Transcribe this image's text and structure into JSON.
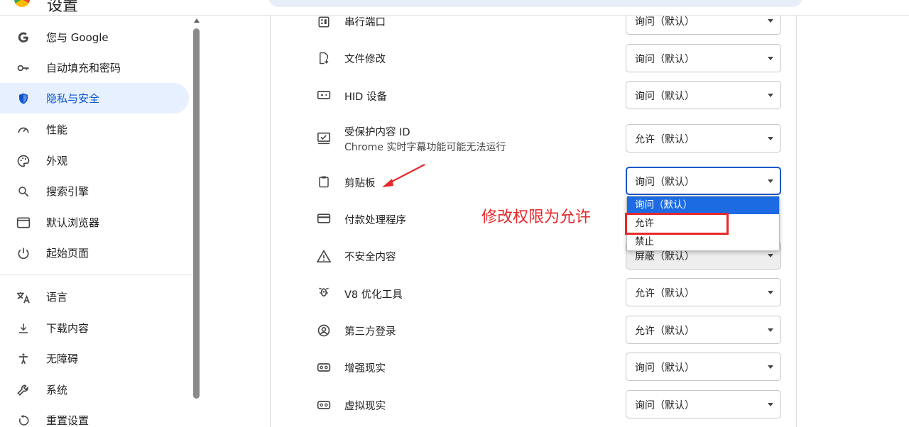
{
  "header": {
    "title": "设置"
  },
  "sidebar": {
    "items": [
      {
        "label": "您与 Google",
        "icon": "google-g-icon"
      },
      {
        "label": "自动填充和密码",
        "icon": "key-icon"
      },
      {
        "label": "隐私与安全",
        "icon": "shield-icon",
        "active": true
      },
      {
        "label": "性能",
        "icon": "gauge-icon"
      },
      {
        "label": "外观",
        "icon": "palette-icon"
      },
      {
        "label": "搜索引擎",
        "icon": "search-icon"
      },
      {
        "label": "默认浏览器",
        "icon": "browser-window-icon"
      },
      {
        "label": "起始页面",
        "icon": "power-icon"
      },
      {
        "label": "语言",
        "icon": "translate-icon"
      },
      {
        "label": "下载内容",
        "icon": "download-icon"
      },
      {
        "label": "无障碍",
        "icon": "accessibility-icon"
      },
      {
        "label": "系统",
        "icon": "wrench-icon"
      },
      {
        "label": "重置设置",
        "icon": "reset-icon"
      }
    ]
  },
  "permissions": [
    {
      "label": "串行端口",
      "icon": "serial-port-icon",
      "value": "询问（默认）"
    },
    {
      "label": "文件修改",
      "icon": "file-edit-icon",
      "value": "询问（默认）"
    },
    {
      "label": "HID 设备",
      "icon": "hid-device-icon",
      "value": "询问（默认）"
    },
    {
      "label": "受保护内容 ID",
      "sublabel": "Chrome 实时字幕功能可能无法运行",
      "icon": "protected-content-icon",
      "value": "允许（默认）"
    },
    {
      "label": "剪贴板",
      "icon": "clipboard-icon",
      "value": "询问（默认）"
    },
    {
      "label": "付款处理程序",
      "icon": "credit-card-icon",
      "value": ""
    },
    {
      "label": "不安全内容",
      "icon": "warning-icon",
      "value": "屏蔽（默认）"
    },
    {
      "label": "V8 优化工具",
      "icon": "v8-icon",
      "value": "允许（默认）"
    },
    {
      "label": "第三方登录",
      "icon": "account-circle-icon",
      "value": "允许（默认）"
    },
    {
      "label": "增强现实",
      "icon": "ar-icon",
      "value": "询问（默认）"
    },
    {
      "label": "虚拟现实",
      "icon": "vr-icon",
      "value": "询问（默认）"
    }
  ],
  "dropdown": {
    "options": [
      "询问（默认）",
      "允许",
      "禁止"
    ],
    "highlighted": 0
  },
  "annotation": {
    "text": "修改权限为允许"
  },
  "colors": {
    "accent": "#0b57d0",
    "highlight": "#1c6be3",
    "annotation": "#e5282b"
  }
}
